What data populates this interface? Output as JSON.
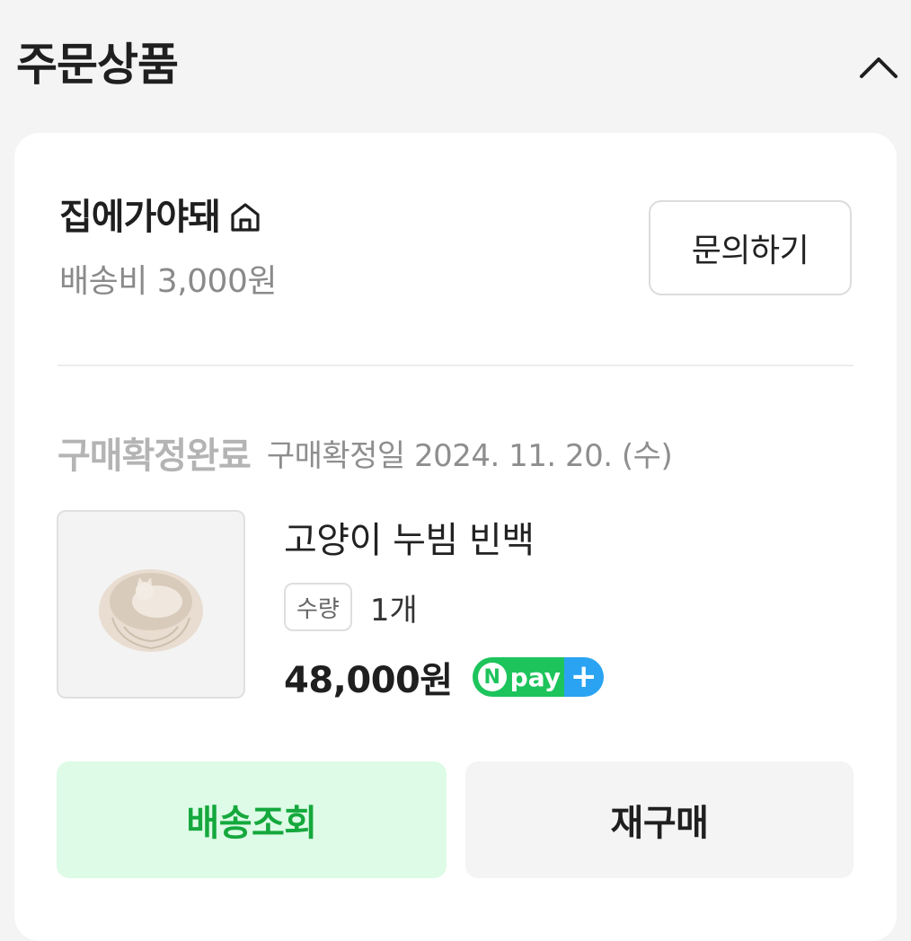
{
  "header": {
    "title": "주문상품",
    "collapse_icon": "chevron-up-icon"
  },
  "seller": {
    "name": "집에가야돼",
    "icon": "home-icon",
    "shipping_fee": "배송비 3,000원",
    "inquiry_label": "문의하기"
  },
  "order": {
    "status": "구매확정완료",
    "confirm_date": "구매확정일 2024. 11. 20. (수)",
    "product": {
      "name": "고양이 누빔 빈백",
      "qty_label": "수량",
      "qty_value": "1개",
      "price": "48,000원",
      "pay_badge": {
        "n": "N",
        "text": "pay",
        "plus": "+"
      }
    }
  },
  "actions": {
    "track_label": "배송조회",
    "reorder_label": "재구매"
  },
  "colors": {
    "accent_green": "#15a83d",
    "track_bg": "#ddfbe6",
    "npay_green": "#1dc45c",
    "npay_blue": "#2aa3f2"
  }
}
